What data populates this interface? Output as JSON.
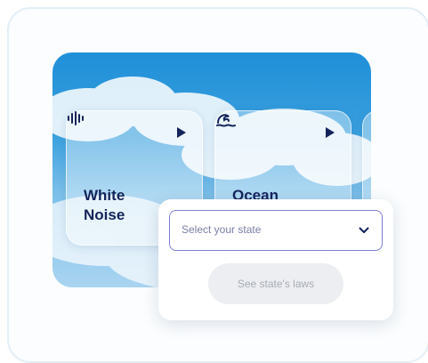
{
  "cards": [
    {
      "title_line1": "White",
      "title_line2": "Noise",
      "icon": "waveform-icon"
    },
    {
      "title_line1": "Ocean",
      "title_line2": "",
      "icon": "wave-icon"
    }
  ],
  "state_select": {
    "placeholder": "Select your state",
    "icon": "chevron-down-icon"
  },
  "laws_button": {
    "label": "See state's laws",
    "state": "disabled"
  },
  "colors": {
    "accent": "#14245b",
    "select_border": "#7d7fd0",
    "button_bg": "#eceef1",
    "button_text": "#a7abb3"
  }
}
